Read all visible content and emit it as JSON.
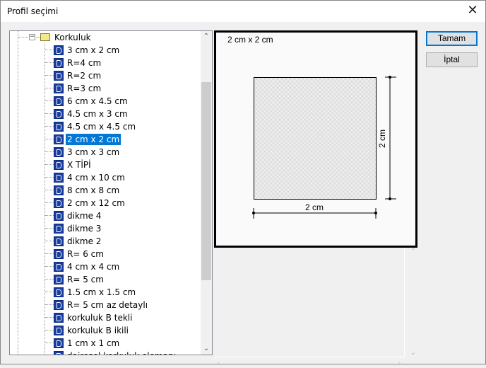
{
  "window": {
    "title": "Profil seçimi"
  },
  "tree": {
    "folder": "Korkuluk",
    "items": [
      "3 cm x 2 cm",
      "R=4 cm",
      "R=2 cm",
      "R=3 cm",
      "6 cm x 4.5 cm",
      "4.5 cm x 3 cm",
      "4.5 cm x 4.5 cm",
      "2 cm x 2 cm",
      "3 cm x 3 cm",
      "X TİPİ",
      "4 cm x 10 cm",
      "8 cm x 8 cm",
      "2 cm x 12 cm",
      "dikme 4",
      "dikme 3",
      "dikme 2",
      "R= 6 cm",
      "4 cm x 4 cm",
      "R= 5 cm",
      "1.5 cm x 1.5 cm",
      "R= 5 cm az detaylı",
      "korkuluk B tekli",
      "korkuluk B ikili",
      "1 cm x 1 cm",
      "dairesel korkuluk elemanı"
    ],
    "selected_index": 7
  },
  "preview": {
    "title": "2 cm x 2 cm",
    "width_label": "2 cm",
    "height_label": "2 cm"
  },
  "buttons": {
    "ok": "Tamam",
    "cancel": "İptal"
  }
}
